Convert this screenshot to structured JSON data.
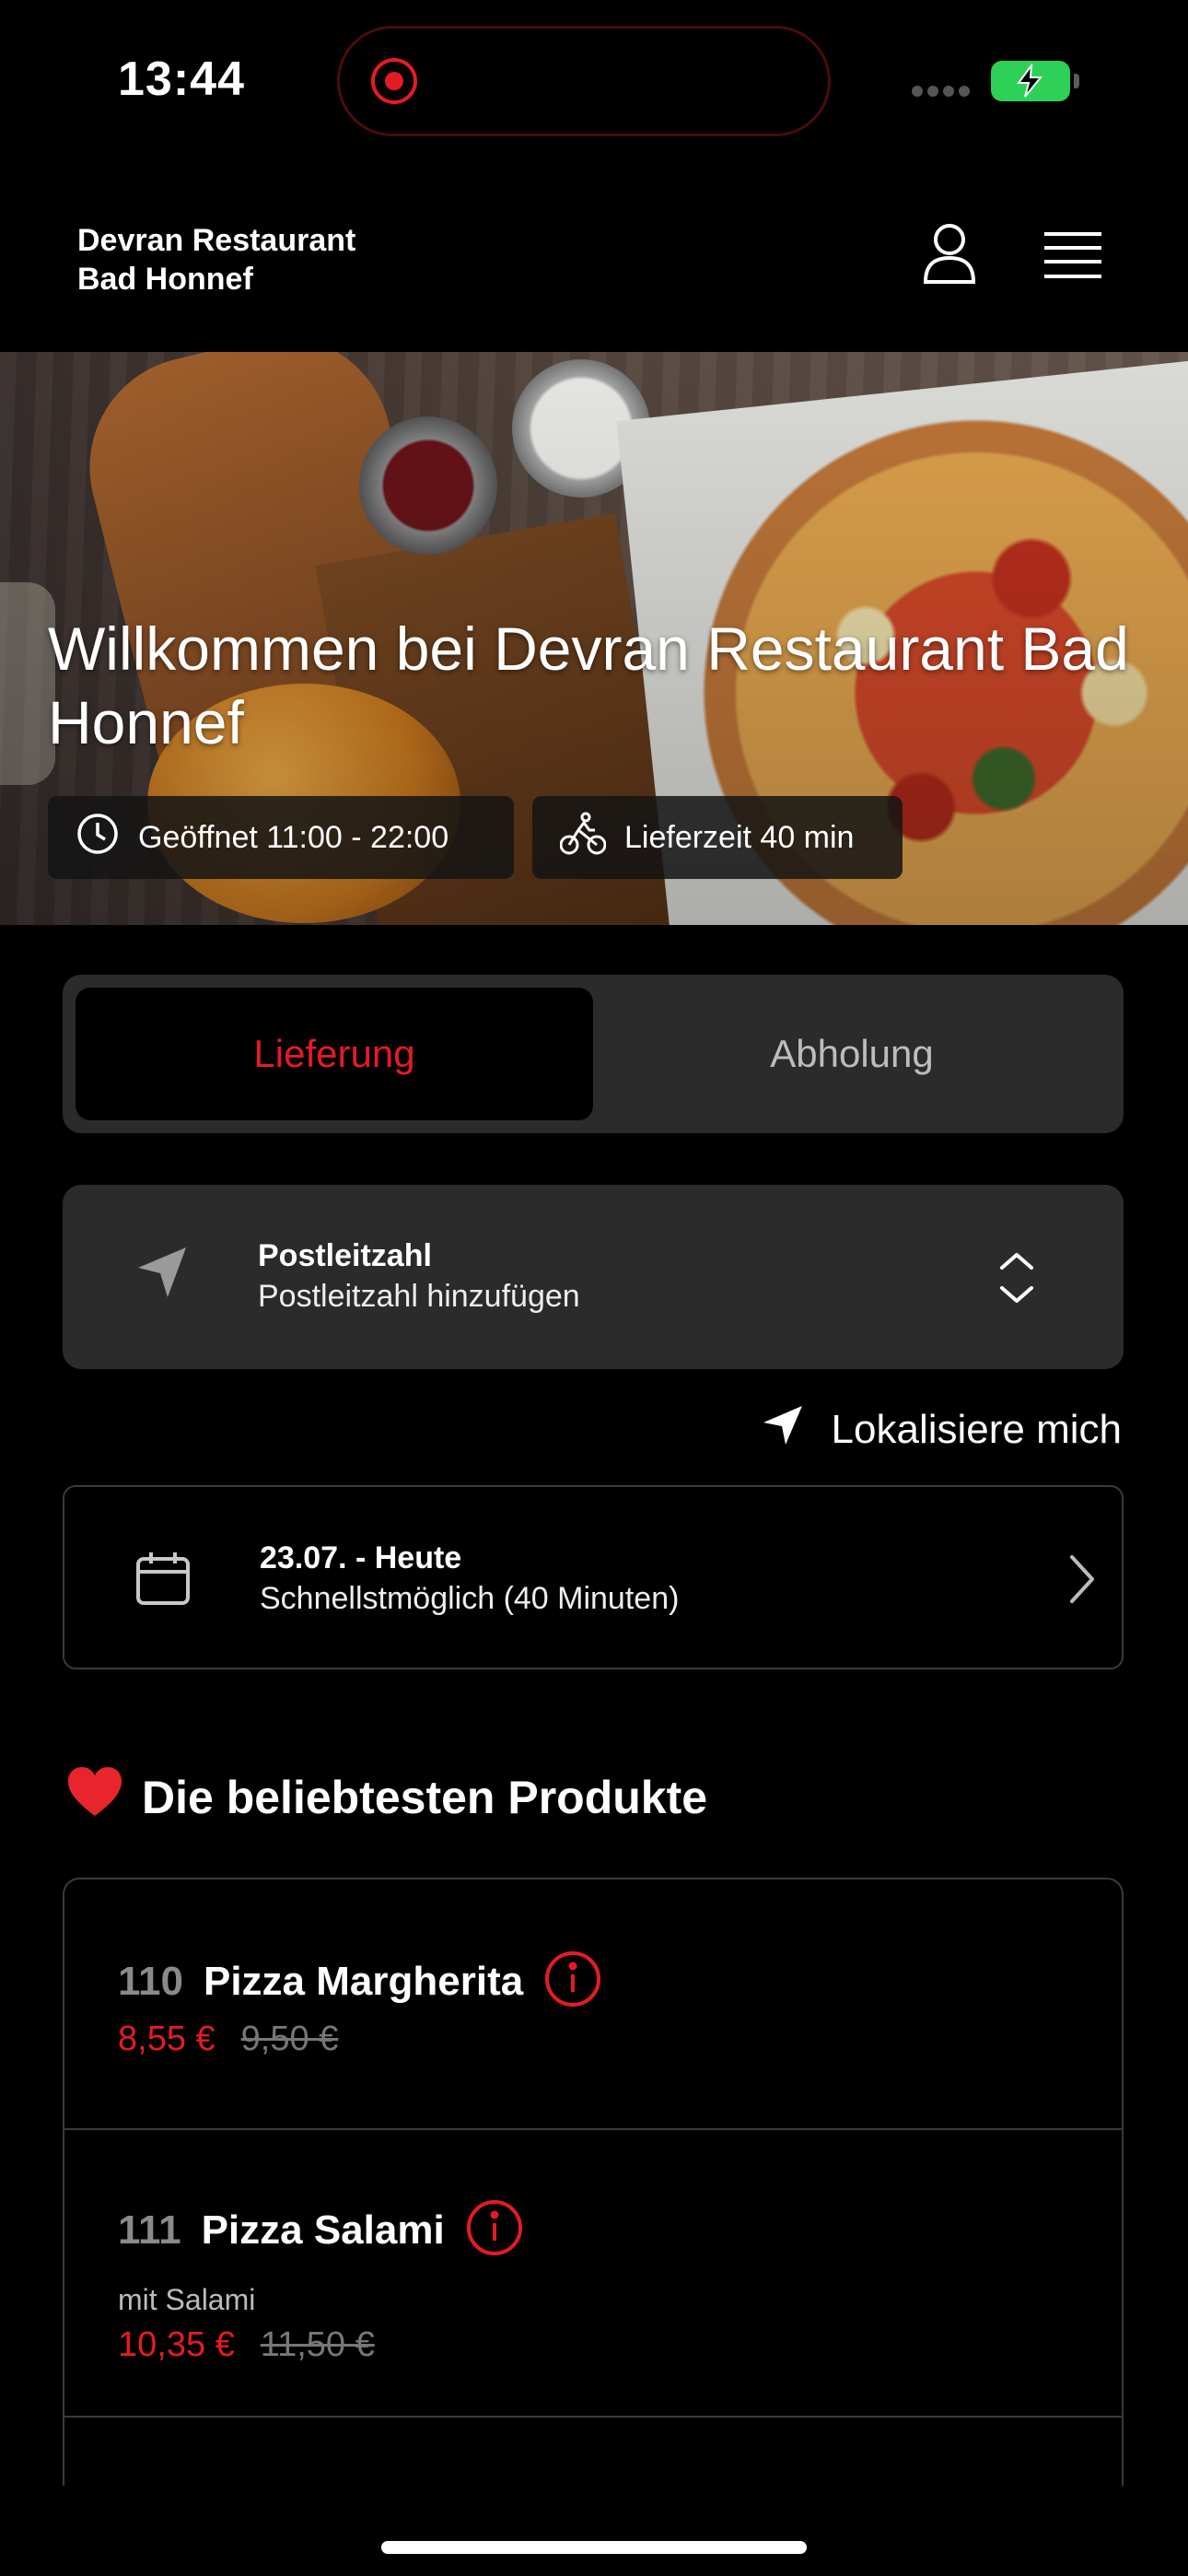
{
  "status_bar": {
    "time": "13:44"
  },
  "header": {
    "restaurant_line1": "Devran Restaurant",
    "restaurant_line2": "Bad Honnef",
    "icons": {
      "account": "user-icon",
      "menu": "hamburger-menu-icon"
    }
  },
  "hero": {
    "title": "Willkommen bei Devran Restaurant Bad Honnef",
    "opening_hours": "Geöffnet 11:00 - 22:00",
    "delivery_time": "Lieferzeit 40 min"
  },
  "order_mode": {
    "options": [
      "Lieferung",
      "Abholung"
    ],
    "selected": "Lieferung"
  },
  "postcode": {
    "label": "Postleitzahl",
    "placeholder": "Postleitzahl hinzufügen"
  },
  "locate_me": "Lokalisiere mich",
  "schedule": {
    "date": "23.07. - Heute",
    "time": "Schnellstmöglich (40 Minuten)"
  },
  "popular": {
    "emoji": "❤️",
    "title": "Die beliebtesten Produkte",
    "products": [
      {
        "number": "110",
        "name": "Pizza Margherita",
        "description": "",
        "price": "8,55 €",
        "old_price": "9,50 €"
      },
      {
        "number": "111",
        "name": "Pizza Salami",
        "description": "mit Salami",
        "price": "10,35 €",
        "old_price": "11,50 €"
      }
    ]
  },
  "colors": {
    "accent": "#e51b24",
    "surface": "#2b2b2b",
    "background": "#000000",
    "battery": "#2ed158"
  }
}
